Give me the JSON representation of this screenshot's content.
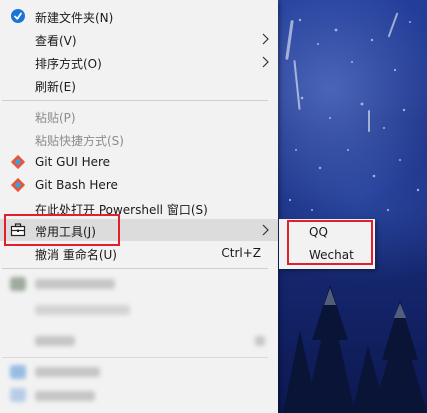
{
  "menu": {
    "items": [
      {
        "label": "新建文件夹(N)",
        "icon": "new-folder-icon",
        "enabled": true
      },
      {
        "label": "查看(V)",
        "submenu": true,
        "enabled": true
      },
      {
        "label": "排序方式(O)",
        "submenu": true,
        "enabled": true
      },
      {
        "label": "刷新(E)",
        "enabled": true
      },
      {
        "label": "粘贴(P)",
        "enabled": false
      },
      {
        "label": "粘贴快捷方式(S)",
        "enabled": false
      },
      {
        "label": "Git GUI Here",
        "icon": "git-icon",
        "enabled": true
      },
      {
        "label": "Git Bash Here",
        "icon": "git-icon",
        "enabled": true
      },
      {
        "label": "在此处打开 Powershell 窗口(S)",
        "enabled": true
      },
      {
        "label": "常用工具(J)",
        "icon": "toolbox-icon",
        "submenu": true,
        "enabled": true,
        "highlighted": true
      },
      {
        "label": "撤消 重命名(U)",
        "shortcut": "Ctrl+Z",
        "enabled": true
      }
    ]
  },
  "submenu": {
    "items": [
      {
        "label": "QQ"
      },
      {
        "label": "Wechat"
      }
    ]
  },
  "colors": {
    "menu_bg": "#f2f2f2",
    "highlight": "#dcdcdc",
    "annotation_red": "#e0202a",
    "disabled_text": "#8c8c8c",
    "wallpaper_blue": "#1b2f80"
  }
}
